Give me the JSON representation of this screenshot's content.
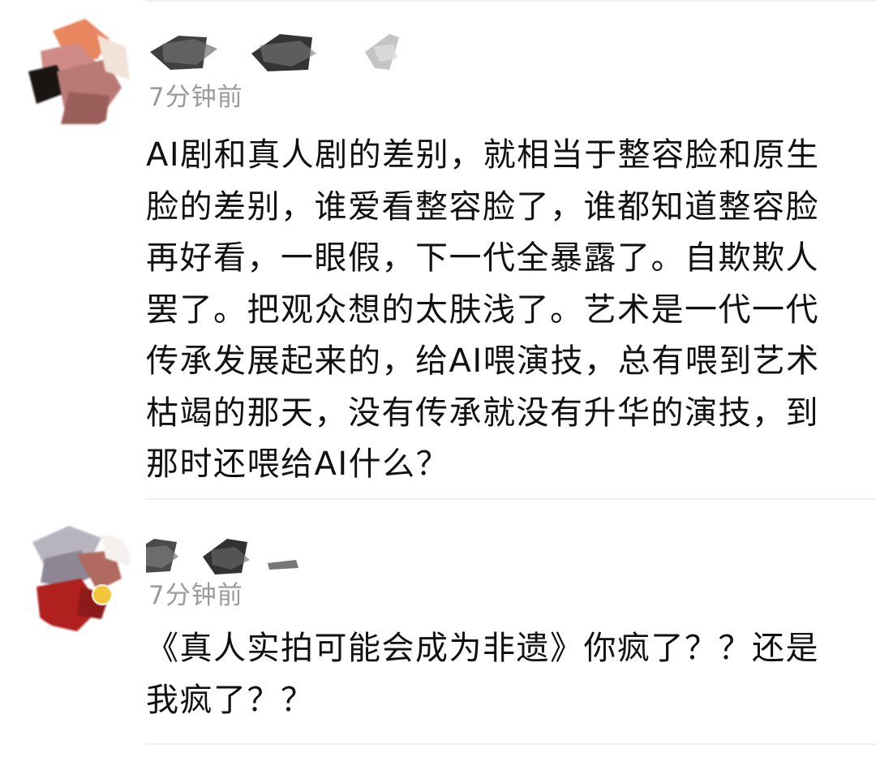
{
  "comments": [
    {
      "avatar_icon": "user-avatar-blurred",
      "username_icon": "redacted-username",
      "timestamp": "7分钟前",
      "text": "AI剧和真人剧的差别，就相当于整容脸和原生脸的差别，谁爱看整容脸了，谁都知道整容脸再好看，一眼假，下一代全暴露了。自欺欺人罢了。把观众想的太肤浅了。艺术是一代一代传承发展起来的，给AI喂演技，总有喂到艺术枯竭的那天，没有传承就没有升华的演技，到那时还喂给AI什么？"
    },
    {
      "avatar_icon": "user-avatar-blurred",
      "username_icon": "redacted-username",
      "badge_icon": "verified-badge-icon",
      "timestamp": "7分钟前",
      "text": "《真人实拍可能会成为非遗》你疯了？？还是我疯了？？"
    }
  ],
  "colors": {
    "text": "#111111",
    "timestamp": "#9b9b9b",
    "divider": "#f0f0f0",
    "badge": "#f3c53a"
  }
}
